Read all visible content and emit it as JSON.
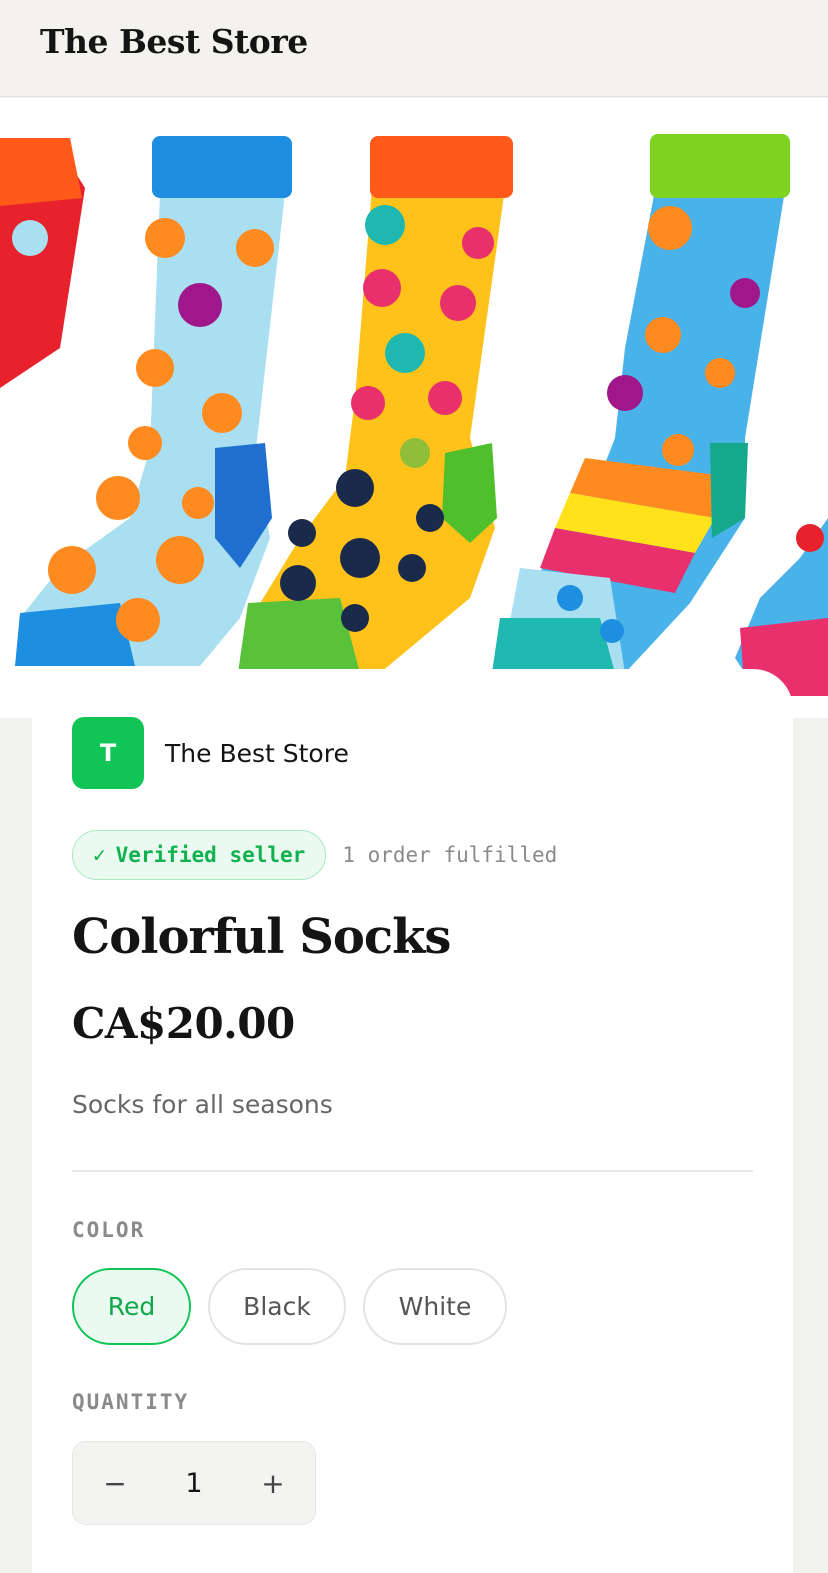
{
  "header": {
    "store_name": "The Best Store"
  },
  "hero": {
    "image_alt": "Colorful Socks",
    "colors": {
      "orange": "#ff8a1f",
      "sky": "#a9dff0",
      "blue": "#1e8fe0",
      "yellow": "#ffc21a",
      "green": "#59c13a",
      "lime": "#7ed321",
      "teal": "#1fb8b0",
      "pink": "#e8306d",
      "red": "#e7222c"
    }
  },
  "seller": {
    "avatar_initial": "T",
    "name": "The Best Store"
  },
  "badges": {
    "verified_icon": "check-icon",
    "verified_mark": "✓",
    "verified_label": "Verified seller",
    "orders_label": "1 order fulfilled"
  },
  "product": {
    "title": "Colorful Socks",
    "price": "CA$20.00",
    "description": "Socks for all seasons"
  },
  "color": {
    "label": "COLOR",
    "options": [
      "Red",
      "Black",
      "White"
    ],
    "selected": "Red"
  },
  "quantity": {
    "label": "QUANTITY",
    "value": "1",
    "decrement": "−",
    "increment": "+"
  },
  "theme": {
    "accent": "#10c456",
    "text": "#141414",
    "muted": "#8a8a8a"
  }
}
